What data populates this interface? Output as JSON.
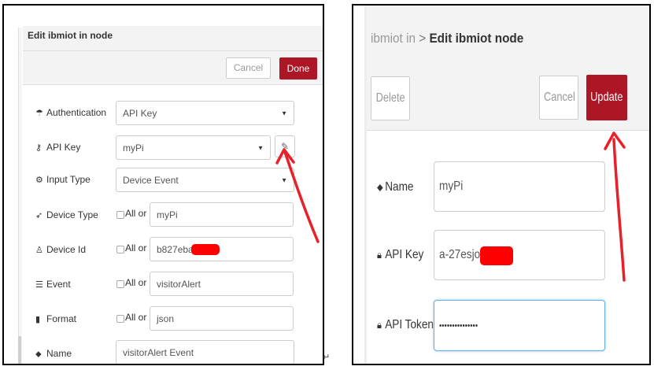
{
  "left_dialog": {
    "title": "Edit ibmiot in node",
    "cancel_label": "Cancel",
    "done_label": "Done",
    "fields": {
      "authentication": {
        "label": "Authentication",
        "value": "API Key"
      },
      "api_key": {
        "label": "API Key",
        "value": "myPi"
      },
      "input_type": {
        "label": "Input Type",
        "value": "Device Event"
      },
      "device_type": {
        "label": "Device Type",
        "all_or": "All or",
        "value": "myPi"
      },
      "device_id": {
        "label": "Device Id",
        "all_or": "All or",
        "value": "b827eba"
      },
      "event": {
        "label": "Event",
        "all_or": "All or",
        "value": "visitorAlert"
      },
      "format": {
        "label": "Format",
        "all_or": "All or",
        "value": "json"
      },
      "name": {
        "label": "Name",
        "value": "visitorAlert Event"
      }
    },
    "icons": {
      "authentication": "umbrella-icon",
      "api_key": "key-icon",
      "input_type": "cogs-icon",
      "device_type": "rocket-icon",
      "device_id": "user-icon",
      "event": "list-icon",
      "format": "file-icon",
      "name": "tag-icon",
      "edit": "pencil-icon"
    }
  },
  "right_dialog": {
    "breadcrumb_parent": "ibmiot in",
    "breadcrumb_sep": ">",
    "breadcrumb_current": "Edit ibmiot node",
    "delete_label": "Delete",
    "cancel_label": "Cancel",
    "update_label": "Update",
    "fields": {
      "name": {
        "label": "Name",
        "value": "myPi"
      },
      "api_key": {
        "label": "API Key",
        "value": "a-27esjo-klk"
      },
      "api_token": {
        "label": "API Token",
        "value": "•••••••••••••••"
      }
    }
  },
  "colors": {
    "primary_button": "#ad1625",
    "annotation_arrow": "#e8202a",
    "redaction": "#ff0000"
  }
}
